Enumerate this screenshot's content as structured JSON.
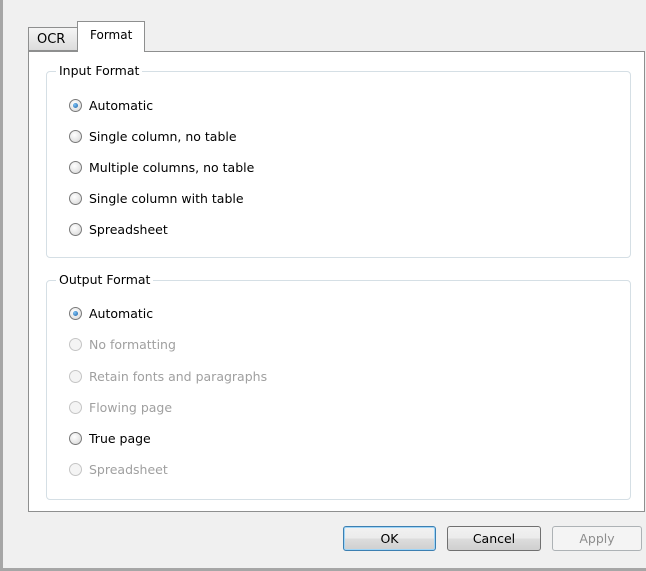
{
  "tabs": [
    {
      "label": "OCR",
      "active": false
    },
    {
      "label": "Format",
      "active": true
    }
  ],
  "input_format": {
    "title": "Input Format",
    "options": [
      {
        "label": "Automatic",
        "checked": true,
        "disabled": false
      },
      {
        "label": "Single column, no table",
        "checked": false,
        "disabled": false
      },
      {
        "label": "Multiple columns, no table",
        "checked": false,
        "disabled": false
      },
      {
        "label": "Single column with table",
        "checked": false,
        "disabled": false
      },
      {
        "label": "Spreadsheet",
        "checked": false,
        "disabled": false
      }
    ]
  },
  "output_format": {
    "title": "Output Format",
    "options": [
      {
        "label": "Automatic",
        "checked": true,
        "disabled": false
      },
      {
        "label": "No formatting",
        "checked": false,
        "disabled": true
      },
      {
        "label": "Retain fonts and paragraphs",
        "checked": false,
        "disabled": true
      },
      {
        "label": "Flowing page",
        "checked": false,
        "disabled": true
      },
      {
        "label": "True page",
        "checked": false,
        "disabled": false
      },
      {
        "label": "Spreadsheet",
        "checked": false,
        "disabled": true
      }
    ]
  },
  "buttons": {
    "ok": "OK",
    "cancel": "Cancel",
    "apply": "Apply"
  },
  "colors": {
    "accent": "#1a5fa3",
    "disabled_text": "#a0a0a0"
  }
}
